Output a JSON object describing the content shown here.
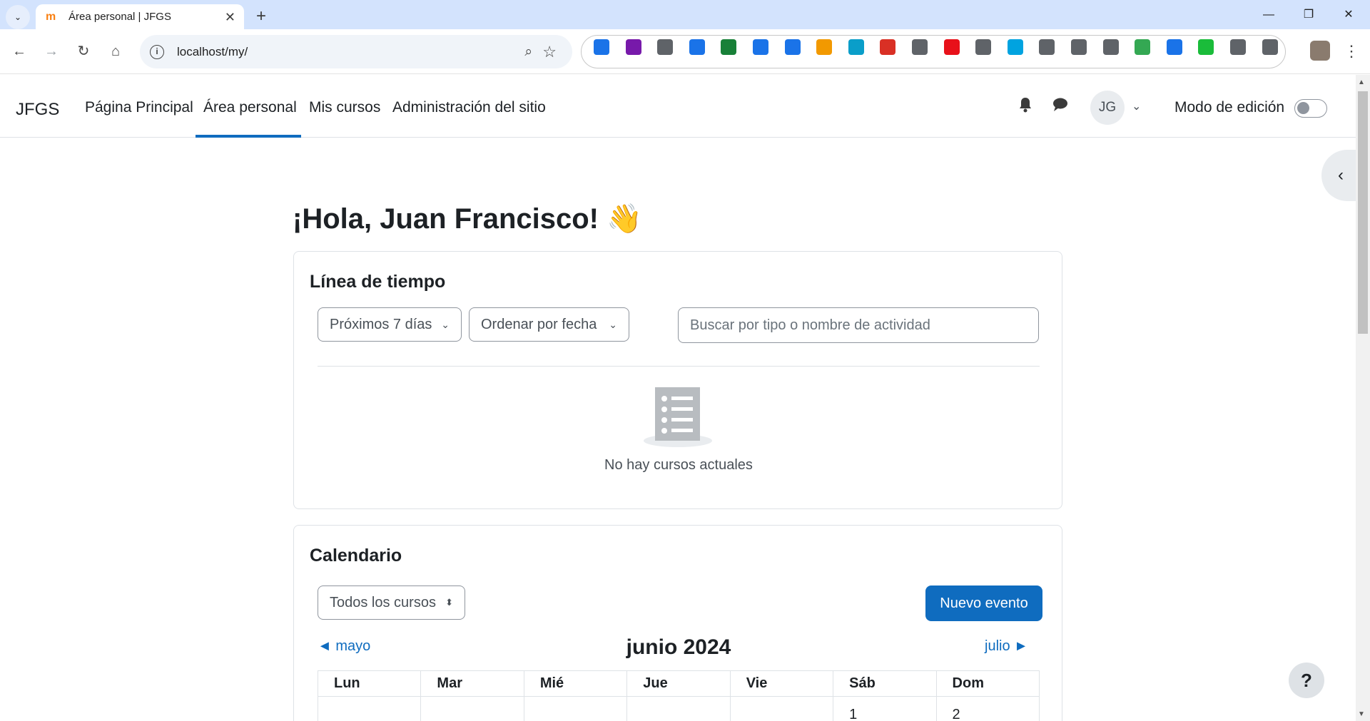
{
  "browser": {
    "tab_title": "Área personal | JFGS",
    "favicon": "m",
    "tab_close": "✕",
    "new_tab": "+",
    "url": "localhost/my/",
    "window_controls": {
      "minimize": "—",
      "restore": "❐",
      "close": "✕"
    },
    "nav": {
      "back": "←",
      "forward": "→",
      "reload": "↻",
      "home": "⌂"
    },
    "extension_colors": [
      "#1a73e8",
      "#7719aa",
      "#5f6368",
      "#1a73e8",
      "#188038",
      "#1a73e8",
      "#1a73e8",
      "#f29900",
      "#0a9ec9",
      "#d93025",
      "#5f6368",
      "#e8111a",
      "#5f6368",
      "#00a3e0",
      "#5f6368",
      "#5f6368",
      "#5f6368",
      "#34a853",
      "#1a73e8",
      "#1abc3a",
      "#5f6368",
      "#5f6368"
    ]
  },
  "navbar": {
    "brand": "JFGS",
    "links": [
      "Página Principal",
      "Área personal",
      "Mis cursos",
      "Administración del sitio"
    ],
    "active_link": "Área personal",
    "user_initials": "JG",
    "edit_mode_label": "Modo de edición",
    "edit_mode_on": false,
    "icons": {
      "bell": "bell-icon",
      "chat": "chat-icon"
    }
  },
  "main": {
    "greeting": "¡Hola, Juan Francisco! 👋",
    "timeline": {
      "title": "Línea de tiempo",
      "filter_label": "Próximos 7 días",
      "sort_label": "Ordenar por fecha",
      "search_placeholder": "Buscar por tipo o nombre de actividad",
      "empty_text": "No hay cursos actuales"
    },
    "calendar": {
      "title": "Calendario",
      "course_select": "Todos los cursos",
      "new_event": "Nuevo evento",
      "prev_month": "◄ mayo",
      "next_month": "julio ►",
      "month_title": "junio 2024",
      "weekdays": [
        "Lun",
        "Mar",
        "Mié",
        "Jue",
        "Vie",
        "Sáb",
        "Dom"
      ],
      "first_week": [
        "",
        "",
        "",
        "",
        "",
        "1",
        "2"
      ]
    }
  },
  "help_button": "?"
}
